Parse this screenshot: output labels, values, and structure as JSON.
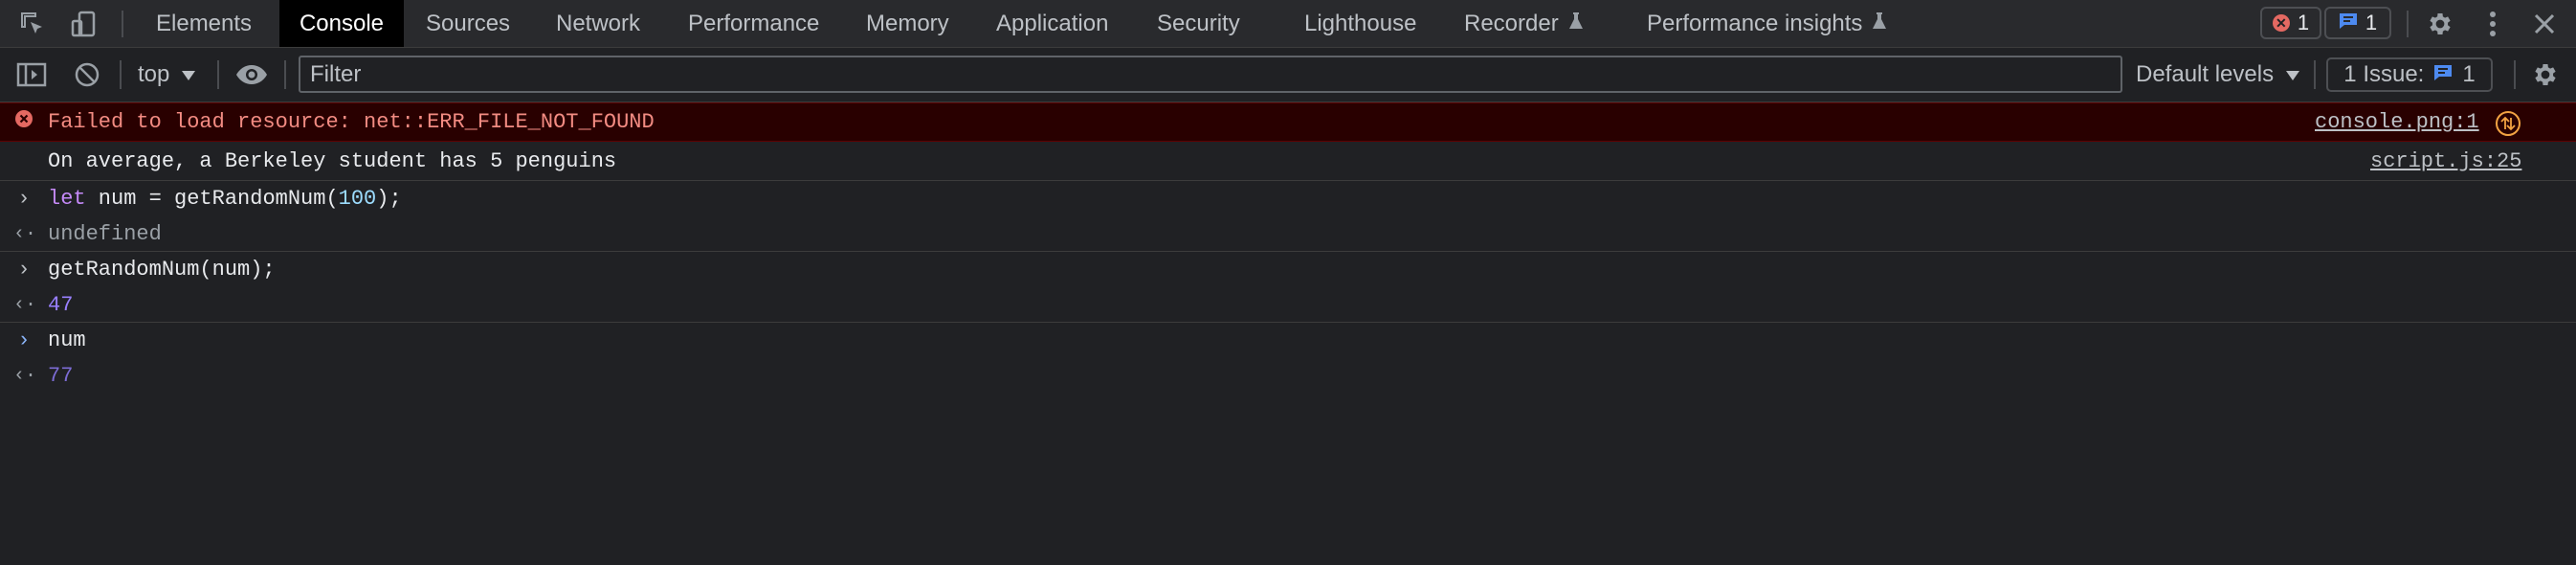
{
  "tabs": [
    {
      "label": "Elements",
      "active": false,
      "experimental": false
    },
    {
      "label": "Console",
      "active": true,
      "experimental": false
    },
    {
      "label": "Sources",
      "active": false,
      "experimental": false
    },
    {
      "label": "Network",
      "active": false,
      "experimental": false
    },
    {
      "label": "Performance",
      "active": false,
      "experimental": false
    },
    {
      "label": "Memory",
      "active": false,
      "experimental": false
    },
    {
      "label": "Application",
      "active": false,
      "experimental": false
    },
    {
      "label": "Security",
      "active": false,
      "experimental": false
    },
    {
      "label": "Lighthouse",
      "active": false,
      "experimental": false
    },
    {
      "label": "Recorder",
      "active": false,
      "experimental": true
    },
    {
      "label": "Performance insights",
      "active": false,
      "experimental": true
    }
  ],
  "status": {
    "error_count": "1",
    "message_count": "1"
  },
  "toolbar": {
    "context": "top",
    "filter_placeholder": "Filter",
    "filter_value": "",
    "levels_label": "Default levels",
    "issues_label": "1 Issue:",
    "issues_count": "1"
  },
  "messages": {
    "error": {
      "text": "Failed to load resource: net::ERR_FILE_NOT_FOUND",
      "source": "console.png:1"
    },
    "info": {
      "text": "On average, a Berkeley student has 5 penguins",
      "source": "script.js:25"
    },
    "cmd1": {
      "kw": "let",
      "pre": " num = getRandomNum(",
      "num": "100",
      "post": ");"
    },
    "out1": "undefined",
    "cmd2": "getRandomNum(num);",
    "out2": "47",
    "cmd3": "num",
    "out3": "77"
  },
  "colors": {
    "background": "#202124",
    "error_row": "#290000",
    "error_text": "#f28b82",
    "accent_blue": "#8ab4f8",
    "number_result": "#9980ff"
  },
  "icons": [
    "inspect-element-icon",
    "device-toolbar-icon",
    "flask-icon",
    "gear-icon",
    "kebab-menu-icon",
    "close-icon",
    "sidebar-toggle-icon",
    "clear-console-icon",
    "eye-icon",
    "error-icon",
    "message-icon",
    "chevron-right-icon",
    "return-arrow-icon",
    "network-request-icon"
  ]
}
